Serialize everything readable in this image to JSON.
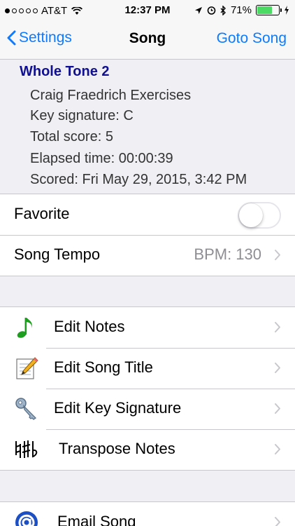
{
  "status_bar": {
    "carrier": "AT&T",
    "time": "12:37 PM",
    "battery": "71%",
    "battery_level": 0.71
  },
  "nav": {
    "back_label": "Settings",
    "title": "Song",
    "right_label": "Goto Song"
  },
  "song_info": {
    "title": "Whole Tone 2",
    "lines": [
      "Craig Fraedrich Exercises",
      "Key signature: C",
      "Total score: 5",
      "Elapsed time: 00:00:39",
      "Scored: Fri May 29, 2015, 3:42 PM"
    ]
  },
  "settings": {
    "favorite_label": "Favorite",
    "favorite_on": false,
    "tempo_label": "Song Tempo",
    "tempo_value": "BPM: 130"
  },
  "actions": [
    {
      "label": "Edit Notes",
      "icon": "music-note-icon"
    },
    {
      "label": "Edit Song Title",
      "icon": "notepad-pencil-icon"
    },
    {
      "label": "Edit Key Signature",
      "icon": "key-icon"
    },
    {
      "label": "Transpose Notes",
      "icon": "accidentals-icon"
    }
  ],
  "share": [
    {
      "label": "Email Song",
      "icon": "at-sign-icon"
    }
  ],
  "colors": {
    "accent": "#0e7aff",
    "title_blue": "#101090",
    "note_green": "#1e9e1e"
  }
}
